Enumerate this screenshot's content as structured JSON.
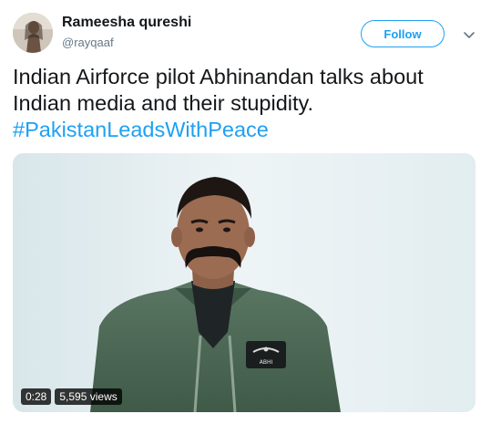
{
  "author": {
    "name": "Rameesha qureshi",
    "handle": "@rayqaaf"
  },
  "actions": {
    "follow_label": "Follow"
  },
  "tweet": {
    "text_line1": "Indian Airforce pilot Abhinandan talks about",
    "text_line2": "Indian media and their stupidity.",
    "hashtag": "#PakistanLeadsWithPeace"
  },
  "video": {
    "duration": "0:28",
    "views": "5,595 views",
    "patch_text": "ABHI"
  },
  "colors": {
    "accent": "#1da1f2",
    "text": "#14171a",
    "secondary_text": "#657786",
    "flight_suit": "#4f6b58"
  },
  "icons": {
    "caret": "chevron-down-icon"
  }
}
